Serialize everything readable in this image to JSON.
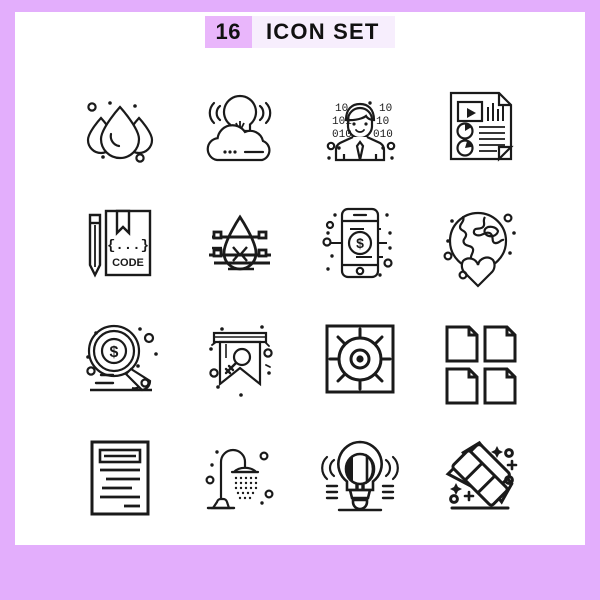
{
  "header": {
    "count": "16",
    "title": "ICON SET"
  },
  "colors": {
    "page_background": "#ffffff",
    "border": "#e3aefc",
    "badge": "#e9b6fb",
    "title_background": "#f7eefd",
    "stroke": "#1a1a1a",
    "text": "#111111"
  },
  "icons": [
    {
      "index": 1,
      "row": 1,
      "col": 1,
      "name": "water-drops-icon",
      "label": "Water Drops"
    },
    {
      "index": 2,
      "row": 1,
      "col": 2,
      "name": "cloud-idea-bulb-icon",
      "label": "Cloud Idea"
    },
    {
      "index": 3,
      "row": 1,
      "col": 3,
      "name": "binary-programmer-icon",
      "label": "Programmer"
    },
    {
      "index": 4,
      "row": 1,
      "col": 4,
      "name": "media-report-document-icon",
      "label": "Media Report"
    },
    {
      "index": 5,
      "row": 2,
      "col": 1,
      "name": "code-book-pencil-icon",
      "label": "Code Book",
      "text": "CODE",
      "braces": "{...}"
    },
    {
      "index": 6,
      "row": 2,
      "col": 2,
      "name": "water-drop-level-icon",
      "label": "Water Level"
    },
    {
      "index": 7,
      "row": 2,
      "col": 3,
      "name": "mobile-payment-icon",
      "label": "Mobile Payment",
      "symbol": "$"
    },
    {
      "index": 8,
      "row": 2,
      "col": 4,
      "name": "globe-heart-icon",
      "label": "World Love"
    },
    {
      "index": 9,
      "row": 3,
      "col": 1,
      "name": "money-search-icon",
      "label": "Money Search",
      "symbol": "$"
    },
    {
      "index": 10,
      "row": 3,
      "col": 2,
      "name": "key-banner-icon",
      "label": "Key Banner"
    },
    {
      "index": 11,
      "row": 3,
      "col": 3,
      "name": "gas-stove-burner-icon",
      "label": "Stove Burner"
    },
    {
      "index": 12,
      "row": 3,
      "col": 4,
      "name": "multiple-files-icon",
      "label": "Files"
    },
    {
      "index": 13,
      "row": 4,
      "col": 1,
      "name": "article-document-icon",
      "label": "Article"
    },
    {
      "index": 14,
      "row": 4,
      "col": 2,
      "name": "shower-icon",
      "label": "Shower"
    },
    {
      "index": 15,
      "row": 4,
      "col": 3,
      "name": "glowing-bulb-icon",
      "label": "Glowing Bulb"
    },
    {
      "index": 16,
      "row": 4,
      "col": 4,
      "name": "cleaning-eraser-icon",
      "label": "Eraser"
    }
  ]
}
